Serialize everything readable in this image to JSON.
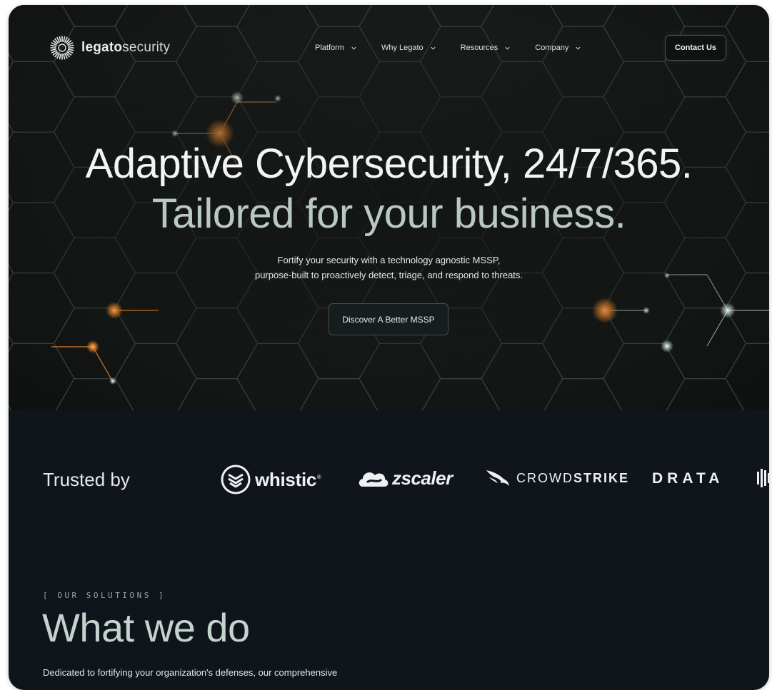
{
  "brand": {
    "name_bold": "legato",
    "name_light": "security"
  },
  "nav": {
    "items": [
      {
        "label": "Platform"
      },
      {
        "label": "Why Legato"
      },
      {
        "label": "Resources"
      },
      {
        "label": "Company"
      }
    ],
    "contact_label": "Contact Us"
  },
  "hero": {
    "headline": "Adaptive Cybersecurity, 24/7/365.",
    "subheadline": "Tailored for your business.",
    "lede_line1": "Fortify your security with a technology agnostic MSSP,",
    "lede_line2": "purpose-built to proactively detect, triage, and respond to threats.",
    "cta_label": "Discover A Better MSSP"
  },
  "trusted": {
    "title": "Trusted by",
    "logos": [
      {
        "name": "whistic",
        "icon": "whistic-logo-icon"
      },
      {
        "name": "zscaler",
        "icon": "zscaler-cloud-icon"
      },
      {
        "name_light": "CROWD",
        "name_bold": "STRIKE",
        "icon": "crowdstrike-falcon-icon"
      },
      {
        "name": "DRATA"
      }
    ]
  },
  "solutions": {
    "eyebrow": "[ OUR SOLUTIONS ]",
    "title": "What we do",
    "body": "Dedicated to fortifying your organization's defenses, our comprehensive"
  },
  "colors": {
    "background": "#0f151b",
    "hero_bg": "#161a18",
    "accent_orange": "#f08a2c",
    "accent_glow": "#cfe8dc",
    "hex_line": "#3b4a46"
  }
}
